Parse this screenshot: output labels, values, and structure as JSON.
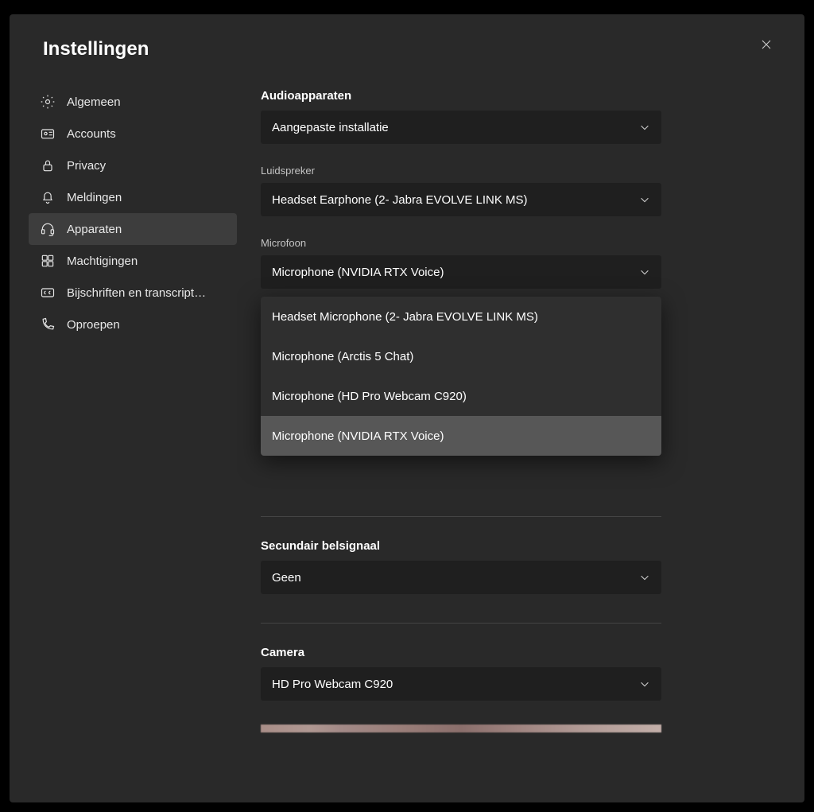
{
  "title": "Instellingen",
  "sidebar": {
    "items": [
      {
        "label": "Algemeen"
      },
      {
        "label": "Accounts"
      },
      {
        "label": "Privacy"
      },
      {
        "label": "Meldingen"
      },
      {
        "label": "Apparaten"
      },
      {
        "label": "Machtigingen"
      },
      {
        "label": "Bijschriften en transcript…"
      },
      {
        "label": "Oproepen"
      }
    ]
  },
  "content": {
    "audioDevices": {
      "heading": "Audioapparaten",
      "value": "Aangepaste installatie"
    },
    "speaker": {
      "label": "Luidspreker",
      "value": "Headset Earphone (2- Jabra EVOLVE LINK MS)"
    },
    "microphone": {
      "label": "Microfoon",
      "value": "Microphone (NVIDIA RTX Voice)",
      "options": [
        "Headset Microphone (2- Jabra EVOLVE LINK MS)",
        "Microphone (Arctis 5 Chat)",
        "Microphone (HD Pro Webcam C920)",
        "Microphone (NVIDIA RTX Voice)"
      ]
    },
    "secondaryRinger": {
      "heading": "Secundair belsignaal",
      "value": "Geen"
    },
    "camera": {
      "heading": "Camera",
      "value": "HD Pro Webcam C920"
    }
  }
}
